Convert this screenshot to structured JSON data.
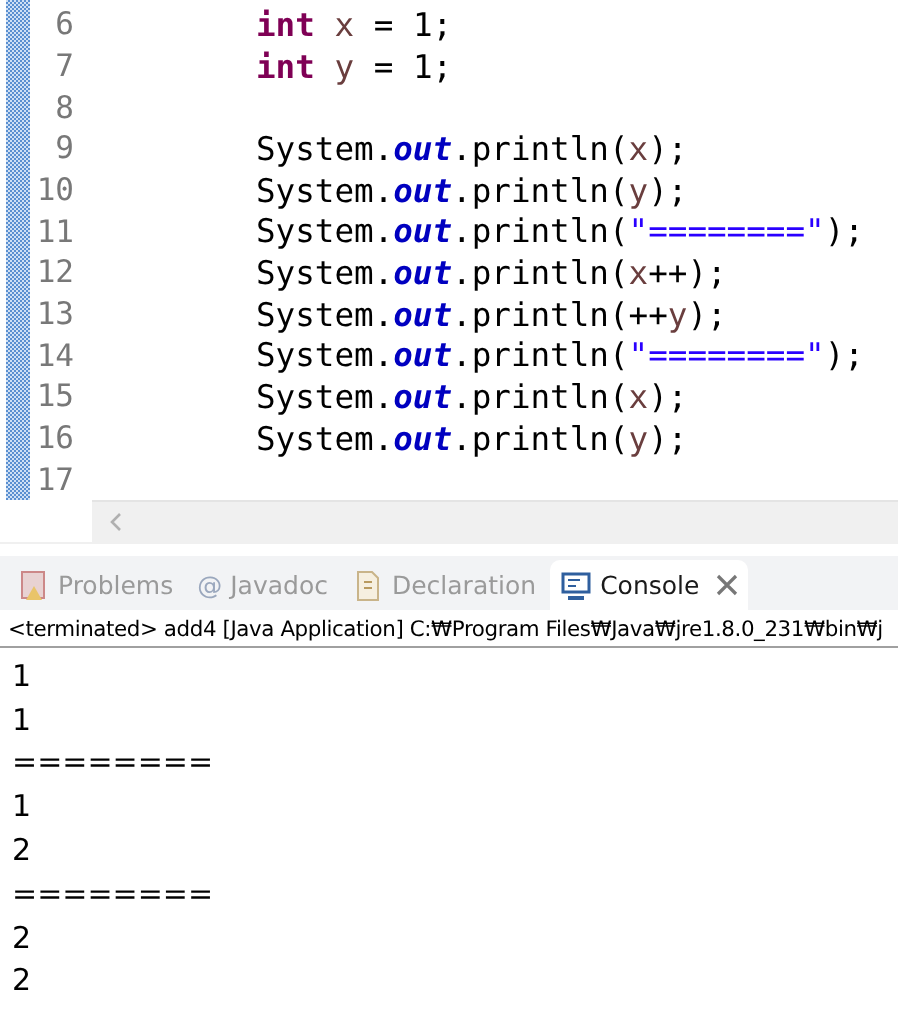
{
  "editor": {
    "lines": [
      {
        "number": "6",
        "tokens": [
          {
            "kind": "keyword",
            "text": "int "
          },
          {
            "kind": "variable",
            "text": "x"
          },
          {
            "kind": "plain",
            "text": " = 1;"
          }
        ]
      },
      {
        "number": "7",
        "tokens": [
          {
            "kind": "keyword",
            "text": "int "
          },
          {
            "kind": "variable",
            "text": "y"
          },
          {
            "kind": "plain",
            "text": " = 1;"
          }
        ]
      },
      {
        "number": "8"
      },
      {
        "number": "9",
        "tokens": [
          {
            "kind": "plain",
            "text": "System."
          },
          {
            "kind": "field",
            "text": "out"
          },
          {
            "kind": "plain",
            "text": ".println("
          },
          {
            "kind": "variable",
            "text": "x"
          },
          {
            "kind": "plain",
            "text": ");"
          }
        ]
      },
      {
        "number": "10",
        "tokens": [
          {
            "kind": "plain",
            "text": "System."
          },
          {
            "kind": "field",
            "text": "out"
          },
          {
            "kind": "plain",
            "text": ".println("
          },
          {
            "kind": "variable",
            "text": "y"
          },
          {
            "kind": "plain",
            "text": ");"
          }
        ]
      },
      {
        "number": "11",
        "tokens": [
          {
            "kind": "plain",
            "text": "System."
          },
          {
            "kind": "field",
            "text": "out"
          },
          {
            "kind": "plain",
            "text": ".println("
          },
          {
            "kind": "string",
            "text": "\"========\""
          },
          {
            "kind": "plain",
            "text": ");"
          }
        ]
      },
      {
        "number": "12",
        "tokens": [
          {
            "kind": "plain",
            "text": "System."
          },
          {
            "kind": "field",
            "text": "out"
          },
          {
            "kind": "plain",
            "text": ".println("
          },
          {
            "kind": "variable",
            "text": "x"
          },
          {
            "kind": "plain",
            "text": "++);"
          }
        ]
      },
      {
        "number": "13",
        "tokens": [
          {
            "kind": "plain",
            "text": "System."
          },
          {
            "kind": "field",
            "text": "out"
          },
          {
            "kind": "plain",
            "text": ".println(++"
          },
          {
            "kind": "variable",
            "text": "y"
          },
          {
            "kind": "plain",
            "text": ");"
          }
        ]
      },
      {
        "number": "14",
        "tokens": [
          {
            "kind": "plain",
            "text": "System."
          },
          {
            "kind": "field",
            "text": "out"
          },
          {
            "kind": "plain",
            "text": ".println("
          },
          {
            "kind": "string",
            "text": "\"========\""
          },
          {
            "kind": "plain",
            "text": ");"
          }
        ]
      },
      {
        "number": "15",
        "tokens": [
          {
            "kind": "plain",
            "text": "System."
          },
          {
            "kind": "field",
            "text": "out"
          },
          {
            "kind": "plain",
            "text": ".println("
          },
          {
            "kind": "variable",
            "text": "x"
          },
          {
            "kind": "plain",
            "text": ");"
          }
        ]
      },
      {
        "number": "16",
        "tokens": [
          {
            "kind": "plain",
            "text": "System."
          },
          {
            "kind": "field",
            "text": "out"
          },
          {
            "kind": "plain",
            "text": ".println("
          },
          {
            "kind": "variable",
            "text": "y"
          },
          {
            "kind": "plain",
            "text": ");"
          }
        ]
      },
      {
        "number": "17"
      }
    ]
  },
  "views": {
    "tabs": [
      {
        "kind": "problems",
        "label": "Problems",
        "selected": false
      },
      {
        "kind": "javadoc",
        "label": "Javadoc",
        "icon_text": "@",
        "selected": false
      },
      {
        "kind": "declaration",
        "label": "Declaration",
        "selected": false
      },
      {
        "kind": "console",
        "label": "Console",
        "selected": true
      }
    ]
  },
  "console": {
    "status": "<terminated> add4 [Java Application] C:₩Program Files₩Java₩jre1.8.0_231₩bin₩j",
    "output": [
      "1",
      "1",
      "========",
      "1",
      "2",
      "========",
      "2",
      "2"
    ]
  }
}
